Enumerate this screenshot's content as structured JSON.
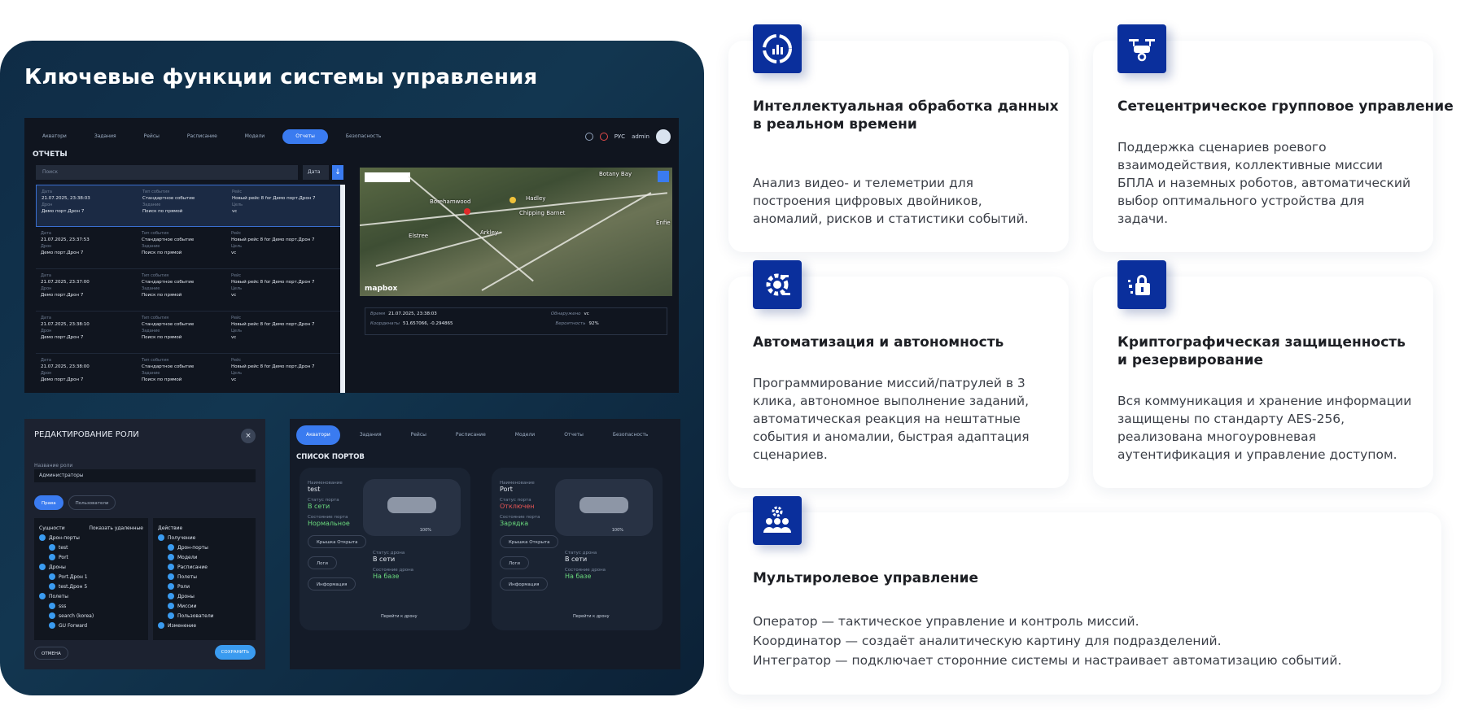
{
  "left": {
    "title": "Ключевые функции системы управления",
    "reports": {
      "nav": [
        "Акватори",
        "Задания",
        "Рейсы",
        "Расписание",
        "Модели",
        "Отчеты",
        "Безопасность"
      ],
      "nav_right": {
        "lang": "РУС",
        "user": "admin"
      },
      "section": "ОТЧЕТЫ",
      "search_placeholder": "Поиск",
      "date_select": "Дата",
      "rows": [
        {
          "date": "21.07.2025, 23:38:03",
          "type": "Стандартное событие",
          "task": "Поиск по прямой",
          "flight": "Новый рейс 8 for Демо порт.Дрон 7",
          "drone": "Демо порт.Дрон 7",
          "target": "vc"
        },
        {
          "date": "21.07.2025, 23:37:53",
          "type": "Стандартное событие",
          "task": "Поиск по прямой",
          "flight": "Новый рейс 8 for Демо порт.Дрон 7",
          "drone": "Демо порт.Дрон 7",
          "target": "vc"
        },
        {
          "date": "21.07.2025, 23:37:00",
          "type": "Стандартное событие",
          "task": "Поиск по прямой",
          "flight": "Новый рейс 8 for Демо порт.Дрон 7",
          "drone": "Демо порт.Дрон 7",
          "target": "vc"
        },
        {
          "date": "21.07.2025, 23:38:10",
          "type": "Стандартное событие",
          "task": "Поиск по прямой",
          "flight": "Новый рейс 8 for Демо порт.Дрон 7",
          "drone": "Демо порт.Дрон 7",
          "target": "vc"
        },
        {
          "date": "21.07.2025, 23:38:00",
          "type": "Стандартное событие",
          "task": "Поиск по прямой",
          "flight": "Новый рейс 8 for Демо порт.Дрон 7",
          "drone": "Демо порт.Дрон 7",
          "target": "vc"
        }
      ],
      "row_labels": {
        "date": "Дата",
        "drone": "Дрон",
        "type": "Тип события",
        "task": "Задание",
        "flight": "Рейс",
        "target": "Цель"
      },
      "map_labels": [
        "Borehamwood",
        "Hadley",
        "Chipping Barnet",
        "Arkley",
        "Elstree",
        "Botany Bay",
        "Enfie"
      ],
      "map_brand": "mapbox",
      "info": {
        "time_label": "Время",
        "time": "21.07.2025, 23:38:03",
        "coords_label": "Координаты",
        "coords": "51.657066, -0.294865",
        "detected_label": "Обнаружено",
        "detected": "vc",
        "prob_label": "Вероятность",
        "prob": "92%"
      }
    },
    "role": {
      "title": "РЕДАКТИРОВАНИЕ РОЛИ",
      "name_label": "Название роли",
      "name_value": "Администраторы",
      "tabs": [
        "Права",
        "Пользователи"
      ],
      "entities_label": "Сущности",
      "show_deleted": "Показать удаленные",
      "actions_label": "Действие",
      "entities": [
        "Дрон-порты",
        "test",
        "Port",
        "Дроны",
        "Port.Дрон 1",
        "test.Дрон 5",
        "Полеты",
        "sss",
        "search (korea)",
        "GU Forward"
      ],
      "actions": [
        "Получение",
        "Дрон-порты",
        "Модели",
        "Расписание",
        "Полеты",
        "Роли",
        "Дроны",
        "Миссии",
        "Пользователи",
        "Изменение"
      ],
      "cancel": "ОТМЕНА",
      "save": "СОХРАНИТЬ"
    },
    "ports": {
      "nav": [
        "Акватори",
        "Задания",
        "Рейсы",
        "Расписание",
        "Модели",
        "Отчеты",
        "Безопасность"
      ],
      "title": "СПИСОК ПОРТОВ",
      "labels": {
        "name": "Наименование",
        "status": "Статус порта",
        "state": "Состояние порта",
        "drone_status": "Статус дрона",
        "drone_state": "Состояние дрона",
        "lid": "Крышка",
        "logs": "Логи",
        "info": "Информация",
        "go": "Перейти к дрону"
      },
      "cards": [
        {
          "name": "test",
          "status": "В сети",
          "state": "Нормальное",
          "drone_status": "В сети",
          "drone_state": "На базе",
          "lid": "Открыта",
          "battery": "100%"
        },
        {
          "name": "Port",
          "status": "Отключен",
          "state": "Зарядка",
          "drone_status": "В сети",
          "drone_state": "На базе",
          "lid": "Открыта",
          "battery": "100%"
        }
      ]
    }
  },
  "features": [
    {
      "icon": "analytics-icon",
      "title": "Интеллектуальная обработка данных\nв реальном времени",
      "text": "Анализ видео- и телеметрии для\nпостроения цифровых двойников,\nаномалий, рисков и статистики событий."
    },
    {
      "icon": "drone-icon",
      "title": "Сетецентрическое групповое управление",
      "text": "Поддержка сценариев роевого\nвзаимодействия, коллективные миссии\nБПЛА и наземных роботов, автоматический\nвыбор оптимального устройства для\nзадачи."
    },
    {
      "icon": "automation-gear-icon",
      "title": "Автоматизация и автономность",
      "text": "Программирование миссий/патрулей в 3\nклика, автономное выполнение заданий,\nавтоматическая реакция на нештатные\nсобытия и аномалии, быстрая адаптация\nсценариев."
    },
    {
      "icon": "lock-icon",
      "title": "Криптографическая защищенность\nи резервирование",
      "text": "Вся коммуникация и хранение информации\nзащищены по стандарту AES-256,\nреализована многоуровневая\nаутентификация и управление доступом."
    },
    {
      "icon": "team-gear-icon",
      "title": "Мультиролевое управление",
      "text": "Оператор — тактическое управление и контроль миссий.\nКоординатор — создаёт аналитическую картину для подразделений.\nИнтегратор — подключает сторонние системы и настраивает автоматизацию событий."
    }
  ],
  "colors": {
    "icon_bg": "#0a2f9c",
    "dark_bg": "#123650",
    "accent": "#3a7bf0"
  }
}
